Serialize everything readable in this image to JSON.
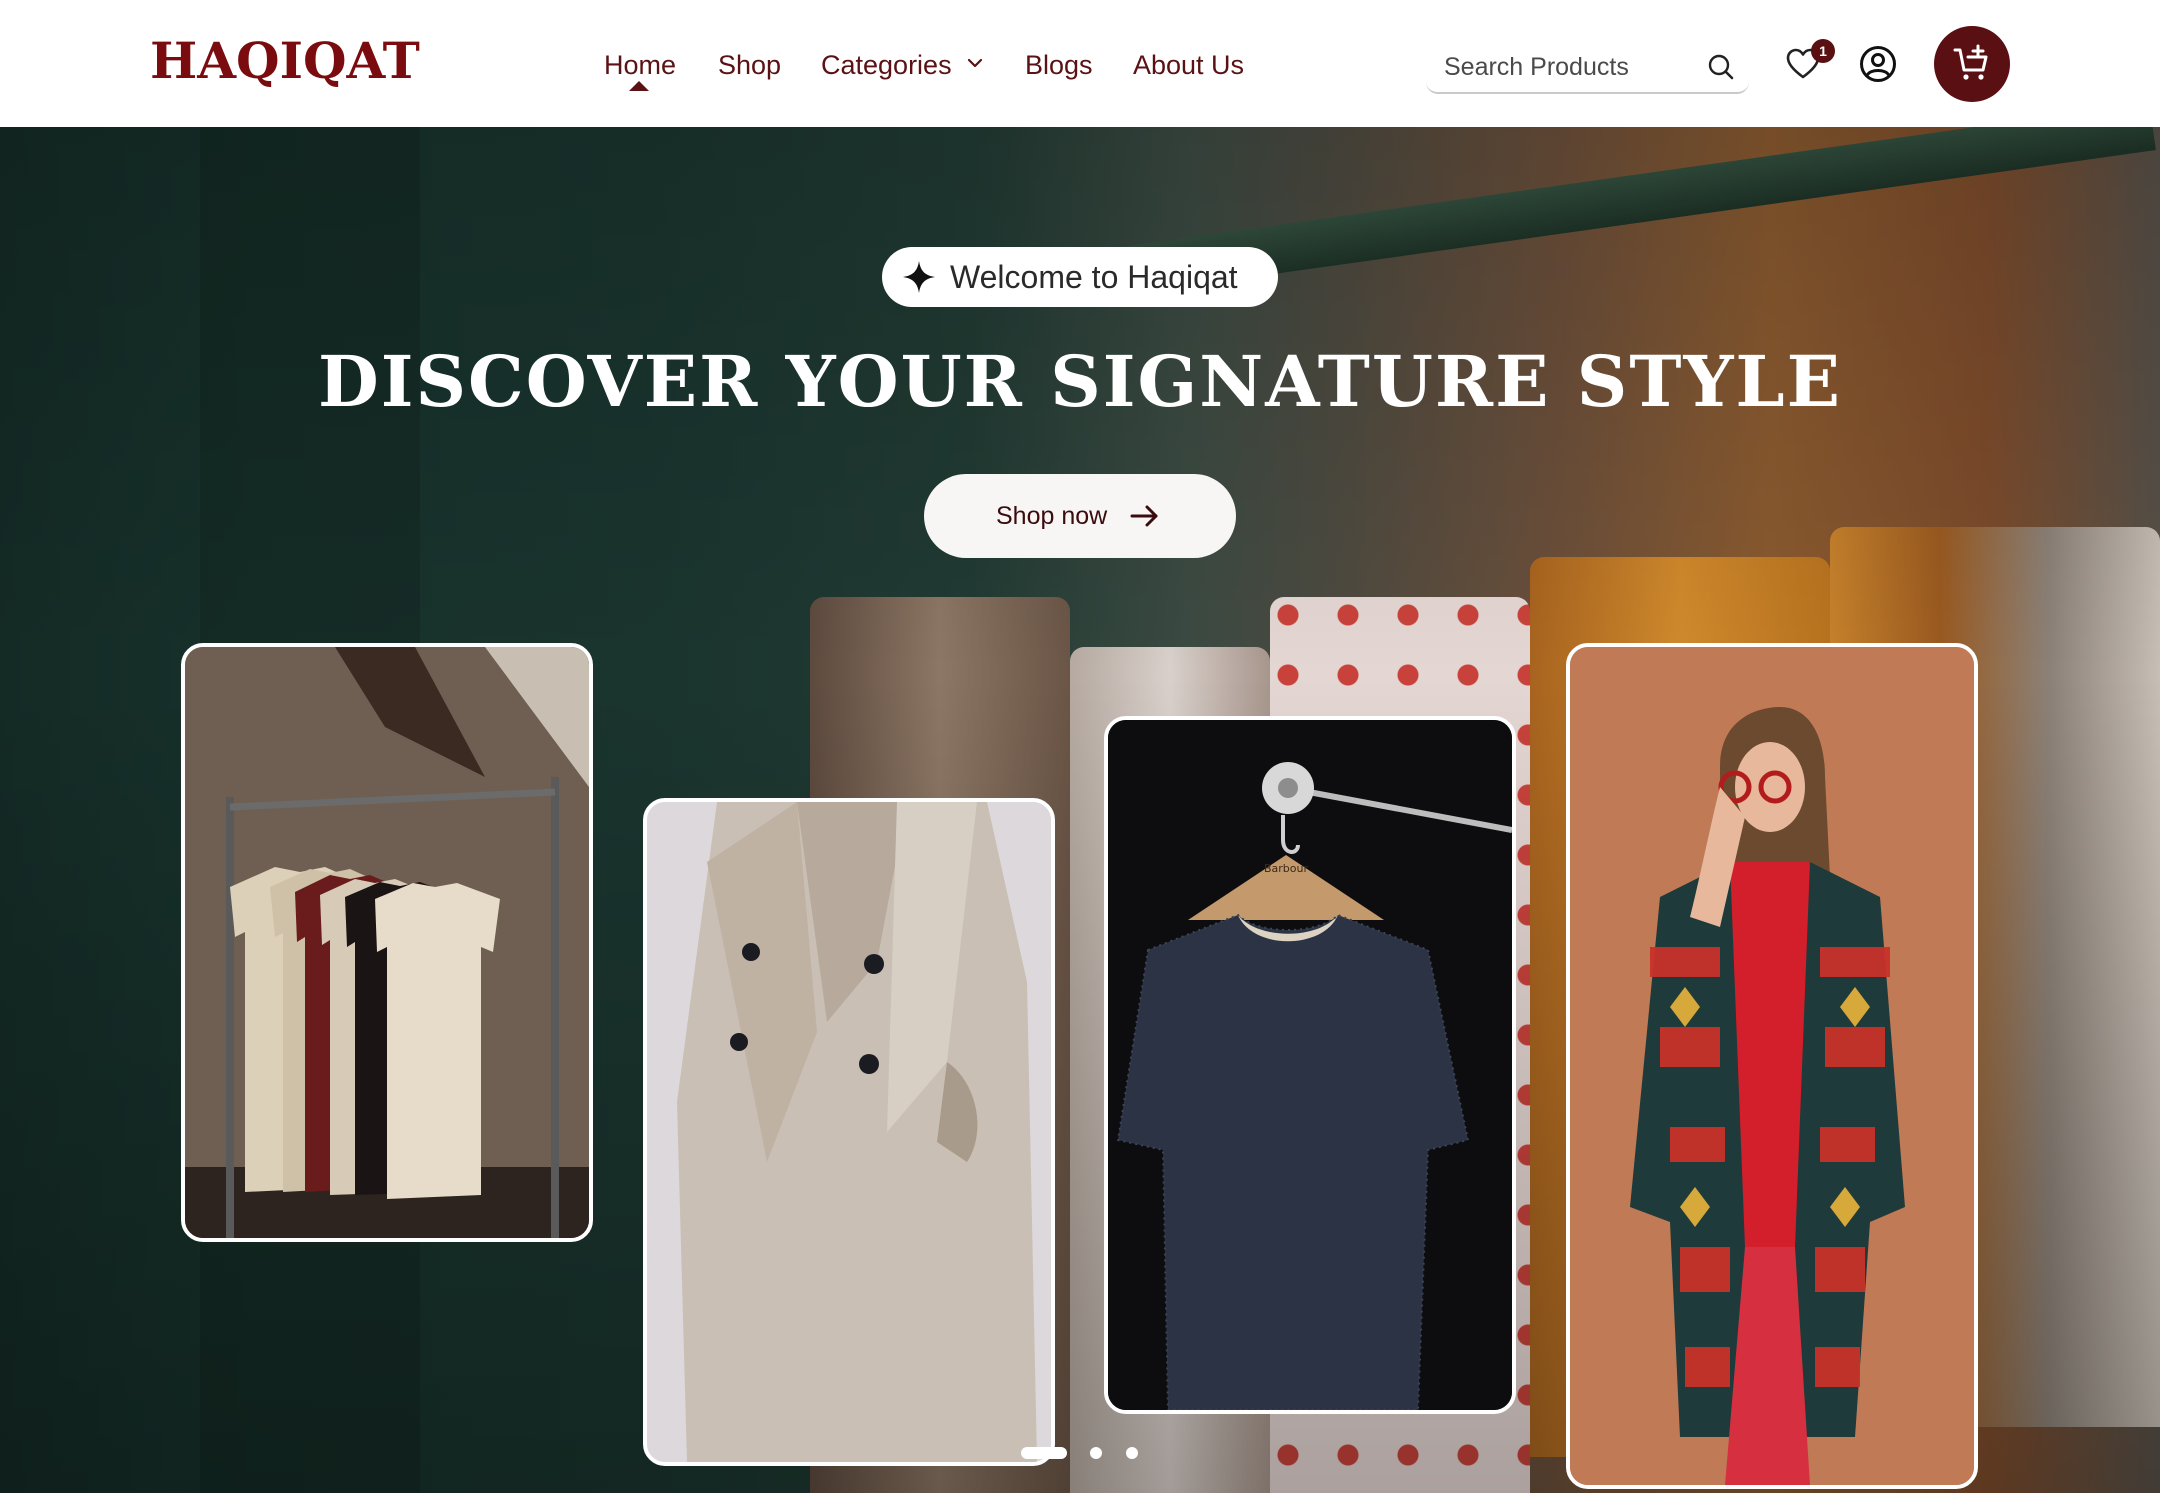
{
  "brand": {
    "logo": "HAQIQAT",
    "accent": "#5a0f12",
    "logo_color": "#7a0c0f"
  },
  "nav": {
    "items": [
      {
        "label": "Home",
        "active": true
      },
      {
        "label": "Shop"
      },
      {
        "label": "Categories",
        "has_dropdown": true
      },
      {
        "label": "Blogs"
      },
      {
        "label": "About Us"
      }
    ]
  },
  "search": {
    "placeholder": "Search Products",
    "icon": "search-icon"
  },
  "header_icons": {
    "wishlist": {
      "icon": "heart-icon",
      "count": "1"
    },
    "account": {
      "icon": "user-icon"
    },
    "cart": {
      "icon": "cart-add-icon"
    }
  },
  "hero": {
    "welcome": "Welcome to Haqiqat",
    "welcome_icon": "sparkle-icon",
    "headline": "DISCOVER YOUR SIGNATURE STYLE",
    "cta": "Shop now",
    "cta_icon": "arrow-right-icon",
    "cards": [
      {
        "name": "t-shirts-on-rack-photo"
      },
      {
        "name": "beige-coat-photo"
      },
      {
        "name": "navy-sweater-on-hanger-photo",
        "hanger_text": "Barbour"
      },
      {
        "name": "woman-patterned-cardigan-photo"
      }
    ],
    "carousel": {
      "slides": 3,
      "active": 1
    }
  }
}
